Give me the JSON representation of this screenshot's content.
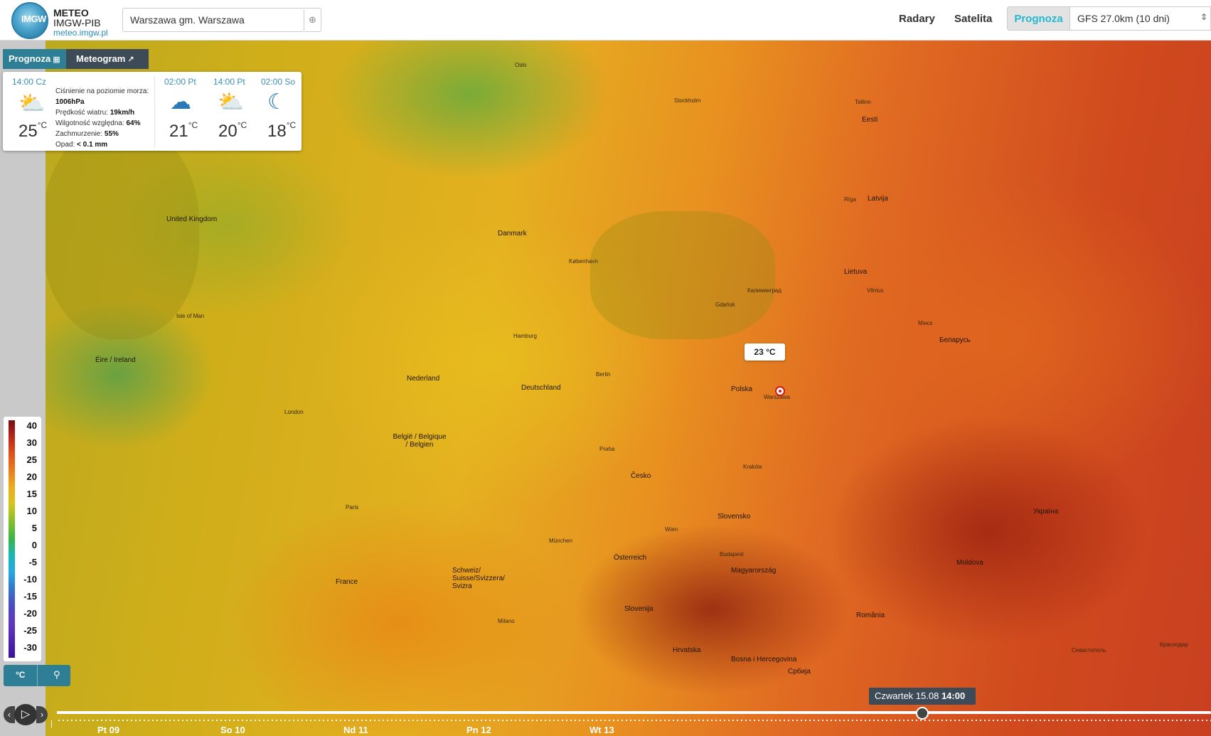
{
  "header": {
    "logo_text": "IMGW",
    "brand_line1": "METEO",
    "brand_line2": "IMGW-PIB",
    "brand_url": "meteo.imgw.pl",
    "search_value": "Warszawa gm. Warszawa",
    "nav_radary": "Radary",
    "nav_satelita": "Satelita",
    "tab_prognoza": "Prognoza",
    "model_select": "GFS 27.0km (10 dni)"
  },
  "panel_tabs": {
    "prognoza": "Prognoza",
    "meteogram": "Meteogram"
  },
  "forecast": {
    "current": {
      "time": "14:00 Cz",
      "temp": "25",
      "unit": "°C",
      "icon": "partly-cloudy-rain-icon",
      "pressure_label": "Ciśnienie na poziomie morza:",
      "pressure_value": "1006hPa",
      "wind_label": "Prędkość wiatru:",
      "wind_value": "19km/h",
      "humidity_label": "Wilgotność względna:",
      "humidity_value": "64%",
      "cloud_label": "Zachmurzenie:",
      "cloud_value": "55%",
      "precip_label": "Opad:",
      "precip_value": "< 0.1 mm"
    },
    "next": [
      {
        "time": "02:00 Pt",
        "temp": "21",
        "unit": "°C",
        "icon": "cloud-rain-icon"
      },
      {
        "time": "14:00 Pt",
        "temp": "20",
        "unit": "°C",
        "icon": "sun-cloud-rain-icon"
      },
      {
        "time": "02:00 So",
        "temp": "18",
        "unit": "°C",
        "icon": "moon-cloud-icon"
      }
    ]
  },
  "map": {
    "temp_tag": "23 °C",
    "labels": {
      "uk": "United Kingdom",
      "ireland": "Éire / Ireland",
      "isle_of_man": "Isle of Man",
      "danmark": "Danmark",
      "nederland": "Nederland",
      "belgie": "België / Belgique / Belgien",
      "deutschland": "Deutschland",
      "france": "France",
      "cesko": "Česko",
      "polska": "Polska",
      "osterreich": "Österreich",
      "schweiz": "Schweiz/ Suisse/Svizzera/ Svizra",
      "slovensko": "Slovensko",
      "magyarorszag": "Magyarország",
      "romania": "România",
      "moldova": "Moldova",
      "ukraina": "Україна",
      "belarus": "Беларусь",
      "lietuva": "Lietuva",
      "latvija": "Latvija",
      "eesti": "Eesti",
      "slovenija": "Slovenija",
      "hrvatska": "Hrvatska",
      "bosna": "Bosna i Hercegovina",
      "srbija": "Србија",
      "warszawa": "Warszawa",
      "berlin": "Berlin",
      "london": "London",
      "paris": "Paris",
      "kraków": "Kraków",
      "gdansk": "Gdańsk",
      "wien": "Wien",
      "budapest": "Budapest",
      "praha": "Praha",
      "oslo": "Oslo",
      "stockholm": "Stockholm",
      "kobenhavn": "København",
      "hamburg": "Hamburg",
      "munchen": "München",
      "milano": "Milano",
      "minsk": "Мінск",
      "riga": "Rīga",
      "vilnius": "Vilnius",
      "tallinn": "Tallinn",
      "kaliningrad": "Калининград",
      "krasnodar": "Краснодар",
      "sevastopol": "Севастополь"
    }
  },
  "legend": {
    "values": [
      "40",
      "30",
      "25",
      "20",
      "15",
      "10",
      "5",
      "0",
      "-5",
      "-10",
      "-15",
      "-20",
      "-25",
      "-30"
    ],
    "unit_button": "°C",
    "pin_icon": "pin-icon"
  },
  "timeline": {
    "days": [
      "Pt 09",
      "So 10",
      "Nd 11",
      "Pn 12",
      "Wt 13"
    ],
    "tooltip_day": "Czwartek 15.08",
    "tooltip_time": "14:00",
    "progress": 0.75
  },
  "colors": {
    "accent": "#23b8d0",
    "tab_active": "#2e7f96",
    "tab_inactive": "#3d4a57",
    "marker": "#d41a1a"
  }
}
